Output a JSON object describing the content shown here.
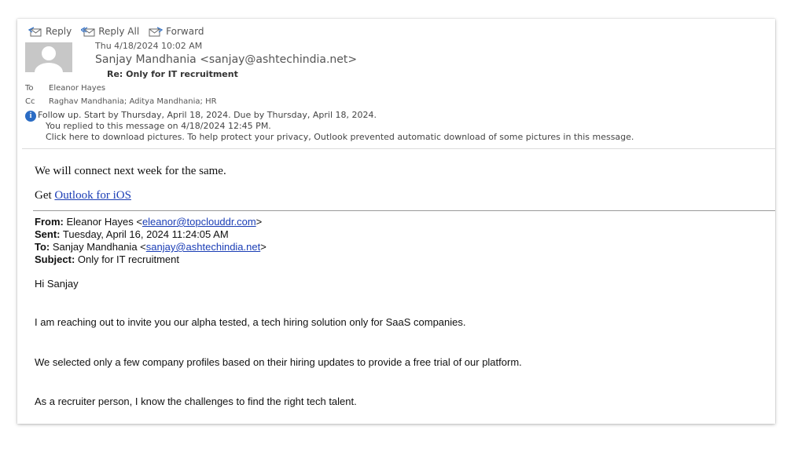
{
  "toolbar": {
    "reply": "Reply",
    "reply_all": "Reply All",
    "forward": "Forward"
  },
  "message": {
    "date": "Thu 4/18/2024 10:02 AM",
    "from": "Sanjay Mandhania <sanjay@ashtechindia.net>",
    "subject": "Re: Only for IT recruitment",
    "to_label": "To",
    "to": "Eleanor Hayes",
    "cc_label": "Cc",
    "cc": "Raghav Mandhania; Aditya Mandhania; HR"
  },
  "info": {
    "followup": "Follow up.  Start by Thursday, April 18, 2024.  Due by Thursday, April 18, 2024.",
    "replied": "You replied to this message on 4/18/2024 12:45 PM.",
    "pictures": "Click here to download pictures. To help protect your privacy, Outlook prevented automatic download of some pictures in this message."
  },
  "reply_body": {
    "line1": "We will connect next week for the same.",
    "get_prefix": "Get ",
    "outlook_link": "Outlook for iOS"
  },
  "original": {
    "from_label": "From:",
    "from_name": " Eleanor Hayes <",
    "from_email": "eleanor@topclouddr.com",
    "from_end": ">",
    "sent_label": "Sent:",
    "sent": " Tuesday, April 16, 2024 11:24:05 AM",
    "to_label": "To:",
    "to_name": " Sanjay Mandhania <",
    "to_email": "sanjay@ashtechindia.net",
    "to_end": ">",
    "subject_label": "Subject:",
    "subject": " Only for IT recruitment",
    "greeting": "Hi Sanjay",
    "p1": "I am reaching out to invite you our alpha tested, a tech hiring solution only for SaaS companies.",
    "p2": "We selected only a few company profiles based on their hiring updates to provide a free trial of our platform.",
    "p3": "As a recruiter person, I know the challenges to find the right tech talent."
  },
  "colors": {
    "link": "#1a3db5",
    "info_icon": "#2b6cc4"
  }
}
